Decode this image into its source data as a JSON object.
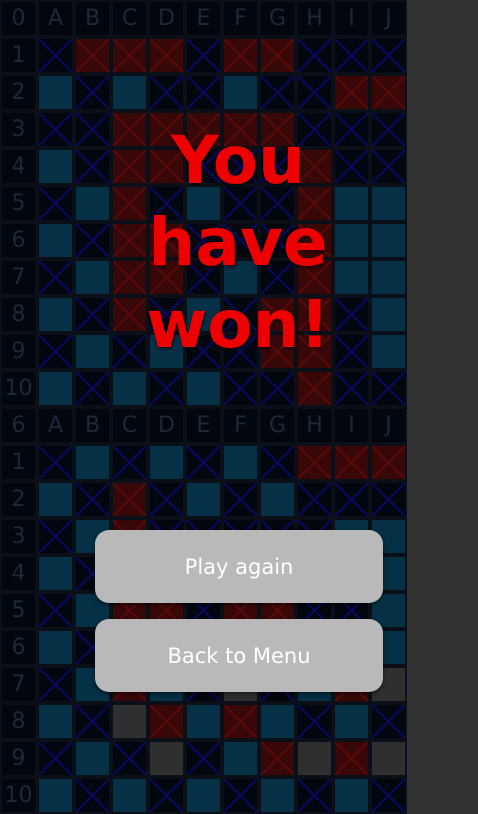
{
  "boards": [
    {
      "id": "top",
      "corner_label": "0",
      "column_labels": [
        "A",
        "B",
        "C",
        "D",
        "E",
        "F",
        "G",
        "H",
        "I",
        "J"
      ],
      "row_labels": [
        "1",
        "2",
        "3",
        "4",
        "5",
        "6",
        "7",
        "8",
        "9",
        "10"
      ],
      "rows": [
        "XHHHXHHXXX",
        "SXSXXSXXHH",
        "XXHHHHHXXX",
        "SXHHXXXHXX",
        "XSHXSXXHSS",
        "SXHHXXXHSS",
        "XSHHXSXHSS",
        "SXHXSXHHXS",
        "XSXSXXHHXS",
        "SXSXSXXHXX"
      ]
    },
    {
      "id": "bottom",
      "corner_label": "6",
      "column_labels": [
        "A",
        "B",
        "C",
        "D",
        "E",
        "F",
        "G",
        "H",
        "I",
        "J"
      ],
      "row_labels": [
        "1",
        "2",
        "3",
        "4",
        "5",
        "6",
        "7",
        "8",
        "9",
        "10"
      ],
      "rows": [
        "XSXSXSXHHH",
        "SXHXSXSXXX",
        "XSHXXXXXSS",
        "SXXXXXXXXS",
        "XSHHXHHXXS",
        "SXXXXXXXXS",
        "XSHSXGXSHG",
        "SXGHSHSXSX",
        "XSXGXSHGHG",
        "SXSXSXSXSX"
      ]
    }
  ],
  "cell_legend": {
    "S": "ship",
    "X": "water-missed",
    "H": "hit",
    "G": "revealed-ship"
  },
  "colors": {
    "win_text": "#ee0000",
    "button_bg": "#b9b9b9",
    "button_text": "#ffffff",
    "ship_cell": "#053045",
    "miss_cross": "#0a0a66",
    "hit_cross": "#5a0a0a",
    "hit_cell": "#380808",
    "gray_cell": "#2f2f2f"
  },
  "overlay": {
    "title": "You have won!",
    "play_again_label": "Play again",
    "back_to_menu_label": "Back to Menu"
  }
}
